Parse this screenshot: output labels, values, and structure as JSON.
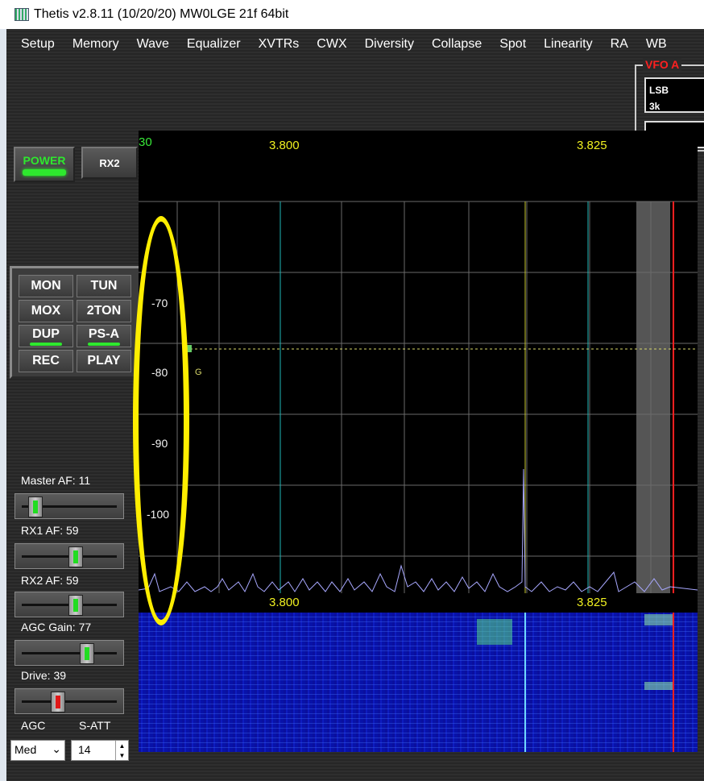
{
  "title": "Thetis v2.8.11 (10/20/20) MW0LGE 21f 64bit",
  "menu": [
    "Setup",
    "Memory",
    "Wave",
    "Equalizer",
    "XVTRs",
    "CWX",
    "Diversity",
    "Collapse",
    "Spot",
    "Linearity",
    "RA",
    "WB"
  ],
  "vfo": {
    "label": "VFO A",
    "mode": "LSB",
    "filter": "3k"
  },
  "buttons": {
    "power": "POWER",
    "rx2": "RX2"
  },
  "panel_buttons": [
    "MON",
    "TUN",
    "MOX",
    "2TON",
    "DUP",
    "PS-A",
    "REC",
    "PLAY"
  ],
  "sliders": [
    {
      "label": "Master AF:  11",
      "value": 11
    },
    {
      "label": "RX1 AF:  59",
      "value": 59
    },
    {
      "label": "RX2 AF:  59",
      "value": 59
    },
    {
      "label": "AGC Gain:  77",
      "value": 77
    },
    {
      "label": "Drive:  39",
      "value": 39
    }
  ],
  "agc_label": "AGC",
  "satt_label": "S-ATT",
  "agc_value": "Med",
  "satt_value": "14",
  "panadapter": {
    "corner_label": "30",
    "freq_labels": [
      "3.800",
      "3.825"
    ],
    "db_labels": [
      "-70",
      "-80",
      "-90",
      "-100"
    ],
    "noise_marker": "G"
  },
  "waterfall_freq_labels": [
    "3.800",
    "3.825"
  ],
  "colors": {
    "accent_green": "#2ee82e",
    "vfo_red": "#ff2020",
    "freq_yellow": "#f0f020",
    "highlight": "#ffee00"
  }
}
